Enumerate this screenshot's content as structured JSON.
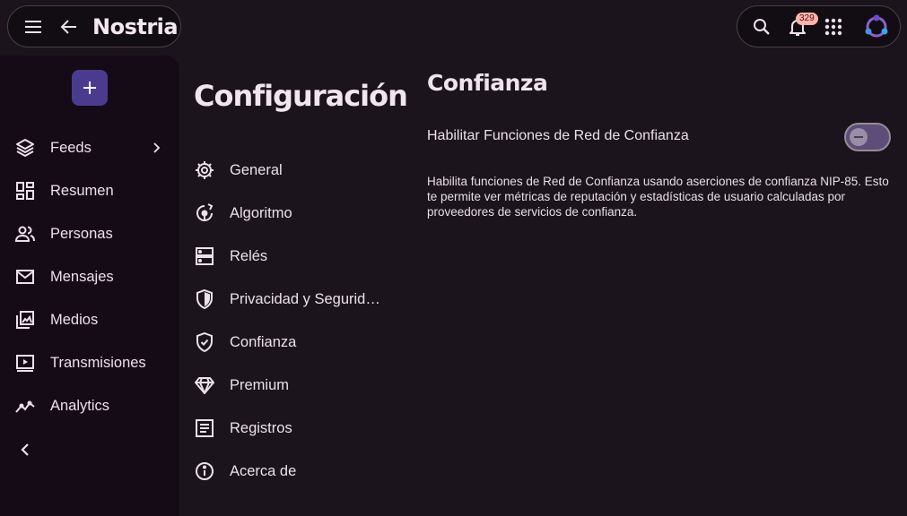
{
  "app": {
    "title": "Nostria"
  },
  "header": {
    "notification_count": "329"
  },
  "sidebar": {
    "items": [
      {
        "label": "Feeds",
        "icon": "layers-icon"
      },
      {
        "label": "Resumen",
        "icon": "dashboard-icon"
      },
      {
        "label": "Personas",
        "icon": "people-icon"
      },
      {
        "label": "Mensajes",
        "icon": "mail-icon"
      },
      {
        "label": "Medios",
        "icon": "photo-library-icon"
      },
      {
        "label": "Transmisiones",
        "icon": "video-play-icon"
      },
      {
        "label": "Analytics",
        "icon": "analytics-icon"
      }
    ]
  },
  "settings": {
    "title": "Configuración",
    "items": [
      {
        "label": "General",
        "icon": "gear-icon"
      },
      {
        "label": "Algoritmo",
        "icon": "algorithm-icon"
      },
      {
        "label": "Relés",
        "icon": "server-icon"
      },
      {
        "label": "Privacidad y Segurid…",
        "icon": "shield-lock-icon"
      },
      {
        "label": "Confianza",
        "icon": "verified-shield-icon"
      },
      {
        "label": "Premium",
        "icon": "diamond-icon"
      },
      {
        "label": "Registros",
        "icon": "list-document-icon"
      },
      {
        "label": "Acerca de",
        "icon": "info-icon"
      }
    ]
  },
  "content": {
    "section_title": "Confianza",
    "toggle_label": "Habilitar Funciones de Red de Confianza",
    "toggle_state": "off",
    "description": "Habilita funciones de Red de Confianza usando aserciones de confianza NIP-85. Esto te permite ver métricas de reputación y estadísticas de usuario calculadas por proveedores de servicios de confianza."
  },
  "colors": {
    "background": "#1b141c",
    "sidebar": "#150b17",
    "accent": "#4b3b8f",
    "badge": "#ffb3ad"
  }
}
